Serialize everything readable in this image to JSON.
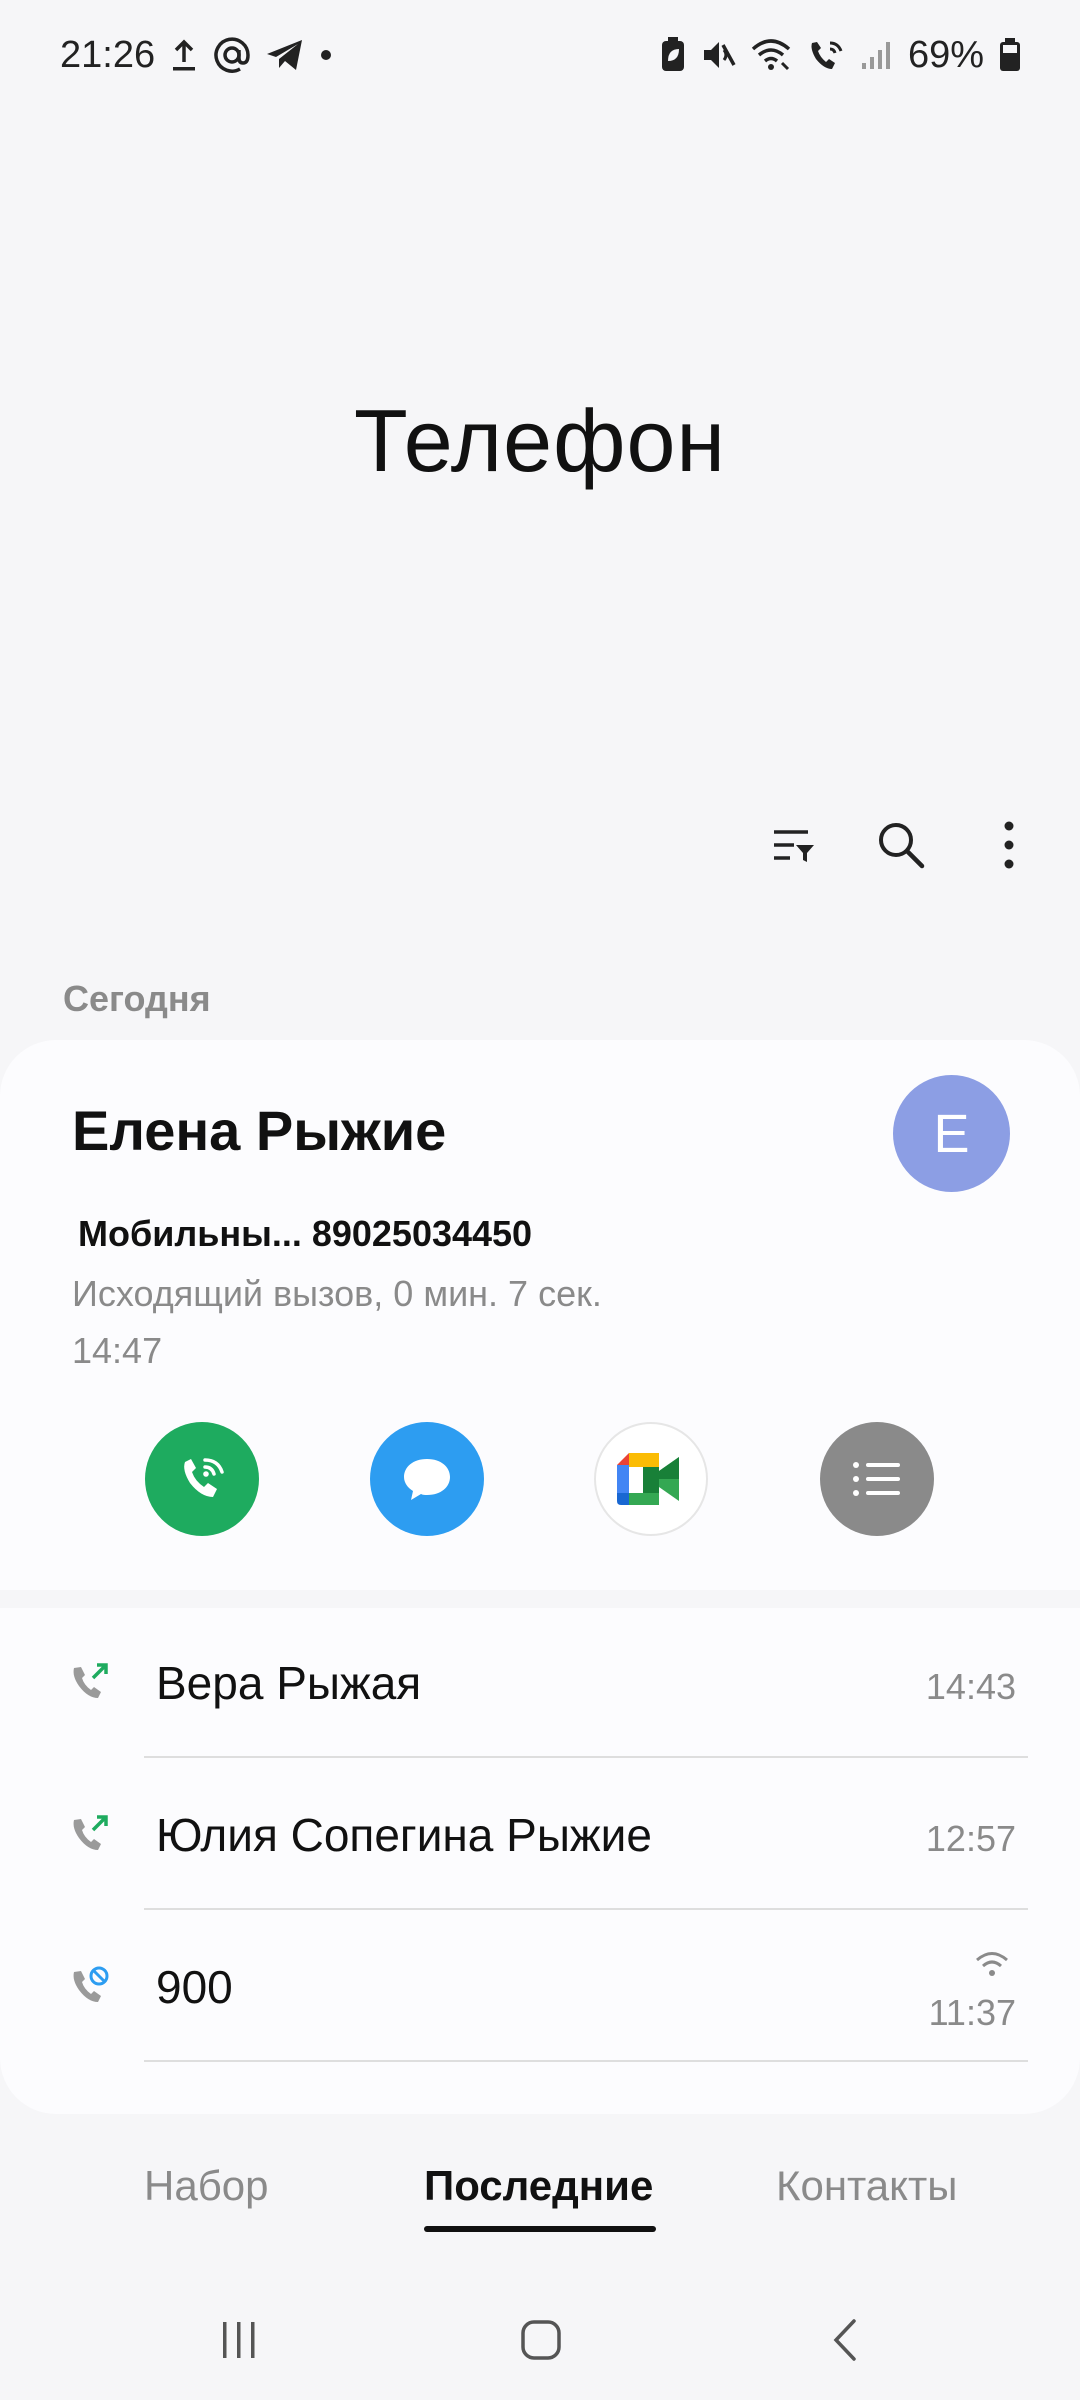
{
  "status_bar": {
    "time": "21:26",
    "battery": "69%",
    "icons_left": [
      "upload-icon",
      "at-icon",
      "telegram-icon",
      "dot-icon"
    ],
    "icons_right": [
      "battery-saver-icon",
      "mute-icon",
      "wifi-icon",
      "wifi-call-icon",
      "signal-icon",
      "battery-icon"
    ]
  },
  "header": {
    "title": "Телефон"
  },
  "toolbar": {
    "icons": [
      "filter-icon",
      "search-icon",
      "more-vert-icon"
    ]
  },
  "section": {
    "today": "Сегодня"
  },
  "expanded_entry": {
    "name": "Елена Рыжие",
    "avatar_letter": "Е",
    "avatar_color": "#8c9ee4",
    "number_line": "Мобильны... 89025034450",
    "description": "Исходящий вызов, 0 мин. 7 сек.",
    "time": "14:47",
    "actions": [
      "call-button",
      "message-button",
      "video-meet-button",
      "details-button"
    ]
  },
  "call_log": [
    {
      "name": "Вера Рыжая",
      "time": "14:43",
      "type": "outgoing"
    },
    {
      "name": "Юлия Сопегина Рыжие",
      "time": "12:57",
      "type": "outgoing"
    },
    {
      "name": "900",
      "time": "11:37",
      "type": "blocked"
    }
  ],
  "tabs": {
    "dial": "Набор",
    "recent": "Последние",
    "contacts": "Контакты",
    "active": "recent"
  },
  "colors": {
    "call_green": "#1eab5f",
    "message_blue": "#2d9df1",
    "details_gray": "#8a8a8a",
    "outgoing_arrow": "#1eab5f",
    "blocked_icon": "#2d9df1"
  }
}
